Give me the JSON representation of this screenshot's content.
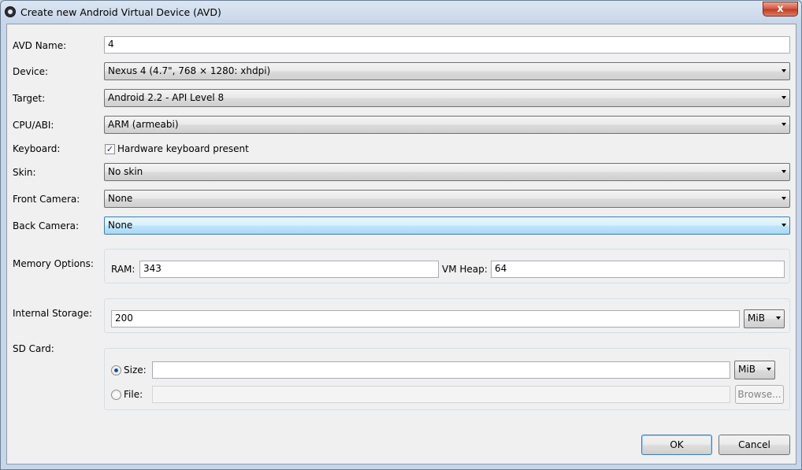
{
  "window": {
    "title": "Create new Android Virtual Device (AVD)",
    "close_glyph": "x"
  },
  "form": {
    "avd_name": {
      "label": "AVD Name:",
      "value": "4"
    },
    "device": {
      "label": "Device:",
      "value": "Nexus 4 (4.7\", 768 × 1280: xhdpi)"
    },
    "target": {
      "label": "Target:",
      "value": "Android 2.2 - API Level 8"
    },
    "cpu_abi": {
      "label": "CPU/ABI:",
      "value": "ARM (armeabi)"
    },
    "keyboard": {
      "label": "Keyboard:",
      "checkbox_label": "Hardware keyboard present",
      "checked": true,
      "check_glyph": "✓"
    },
    "skin": {
      "label": "Skin:",
      "value": "No skin"
    },
    "front_camera": {
      "label": "Front Camera:",
      "value": "None"
    },
    "back_camera": {
      "label": "Back Camera:",
      "value": "None"
    },
    "memory": {
      "label": "Memory Options:",
      "ram_label": "RAM:",
      "ram_value": "343",
      "vm_heap_label": "VM Heap:",
      "vm_heap_value": "64"
    },
    "internal_storage": {
      "label": "Internal Storage:",
      "value": "200",
      "unit": "MiB"
    },
    "sd_card": {
      "label": "SD Card:",
      "size_label": "Size:",
      "size_value": "",
      "size_unit": "MiB",
      "size_selected": true,
      "file_label": "File:",
      "file_value": "",
      "browse_label": "Browse..."
    }
  },
  "buttons": {
    "ok": "OK",
    "cancel": "Cancel"
  },
  "colors": {
    "focus_accent": "#3c7fb1",
    "close_button": "#c0381f"
  }
}
